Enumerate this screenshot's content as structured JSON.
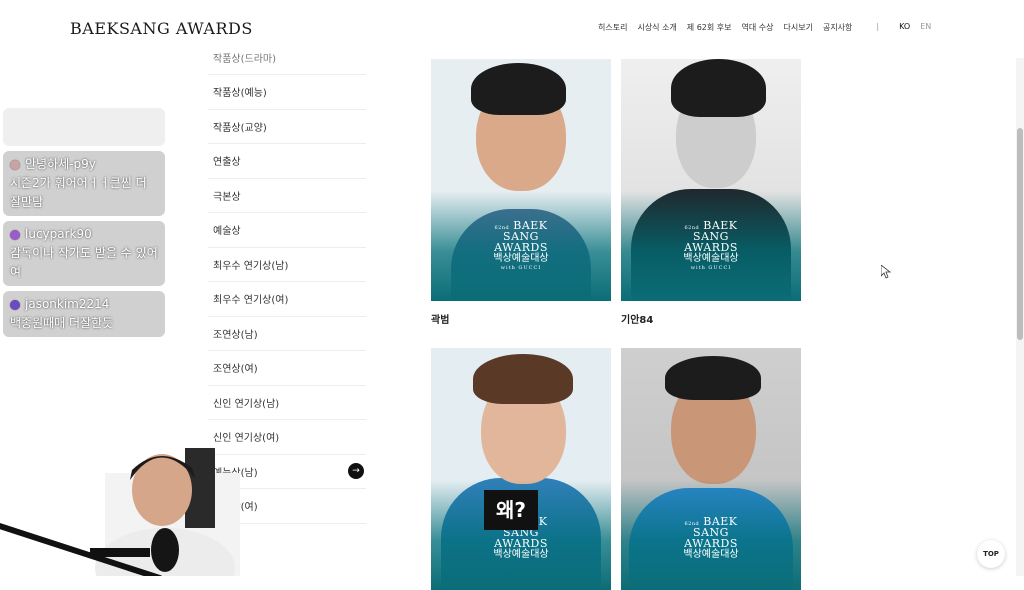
{
  "header": {
    "logo": "BAEKSANG AWARDS",
    "nav": [
      "히스토리",
      "시상식 소개",
      "제 62회 후보",
      "역대 수상",
      "다시보기",
      "공지사항"
    ],
    "separator": "|",
    "lang_ko": "KO",
    "lang_en": "EN"
  },
  "categories": [
    "작품상(드라마)",
    "작품상(예능)",
    "작품상(교양)",
    "연출상",
    "극본상",
    "예술상",
    "최우수 연기상(남)",
    "최우수 연기상(여)",
    "조연상(남)",
    "조연상(여)",
    "신인 연기상(남)",
    "신인 연기상(여)",
    "예능상(남)",
    "예능상(여)"
  ],
  "active_arrow": "→",
  "nominees": [
    {
      "name": "곽범"
    },
    {
      "name": "기안84"
    },
    {
      "name": ""
    },
    {
      "name": ""
    }
  ],
  "award_badge": {
    "edition": "62nd",
    "line1": "BAEK",
    "line2": "SANG",
    "line3": "AWARDS",
    "korean": "백상예술대상",
    "sponsor": "with GUCCI"
  },
  "chat": {
    "faded_user": "",
    "faded_text": "",
    "messages": [
      {
        "user": "안녕하세-p9y",
        "text": "시즌2가 훠어어ㅓㅓ큰씬 더 잘만담",
        "color": "#c9a3a3"
      },
      {
        "user": "lucypark90",
        "text": "감독이나 작가도 받을 수 있어여",
        "color": "#9b5cc9"
      },
      {
        "user": "jasonkim2214",
        "text": "백종원때매 더잘한듯",
        "color": "#6b4bc2"
      }
    ]
  },
  "subtitle": "왜?",
  "top_button": "TOP"
}
